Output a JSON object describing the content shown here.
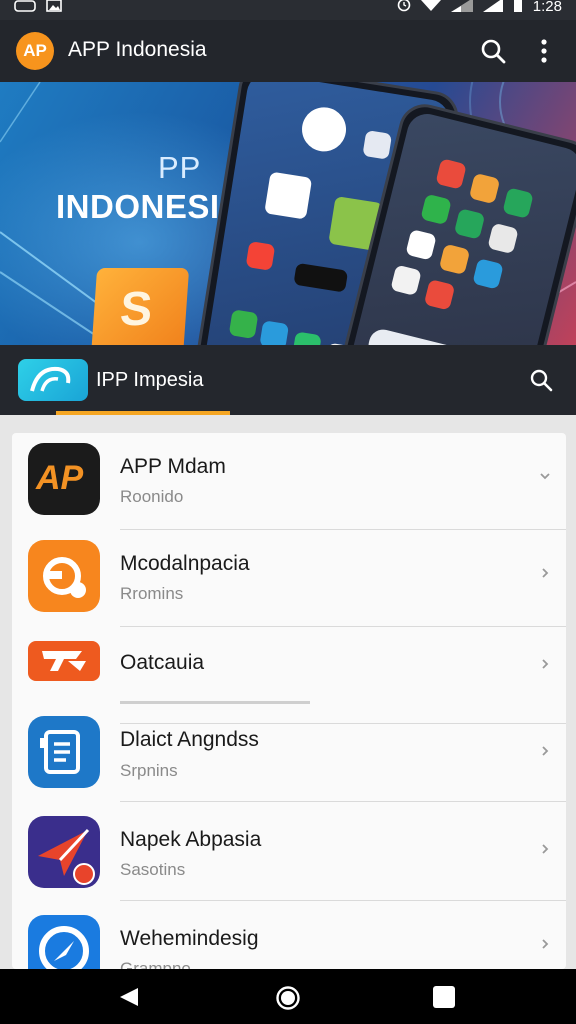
{
  "status_bar": {
    "time": "1:28"
  },
  "app_bar": {
    "logo_text": "AP",
    "title": "APP Indonesia"
  },
  "banner": {
    "subtitle": "PP",
    "title": "INDONESIA",
    "tile_letter": "S"
  },
  "tab": {
    "label": "IPP Impesia"
  },
  "apps": [
    {
      "name": "APP Mdam",
      "subtitle": "Roonido",
      "icon_text": "AP",
      "icon_color": "#1b1b1b",
      "accent": "#f39224"
    },
    {
      "name": "Mcodalnpacia",
      "subtitle": "Rromins",
      "icon_text": "",
      "icon_color": "#f7861e",
      "accent": "#ffffff"
    },
    {
      "name": "Oatcauia",
      "subtitle": "",
      "icon_text": "",
      "icon_color": "#ee5a1f",
      "accent": "#ffffff"
    },
    {
      "name": "Dlaict Angndss",
      "subtitle": "Srpnins",
      "icon_text": "",
      "icon_color": "#1e78c8",
      "accent": "#ffffff"
    },
    {
      "name": "Napek Abpasia",
      "subtitle": "Sasotins",
      "icon_text": "",
      "icon_color": "#3a2e8c",
      "accent": "#e8442b"
    },
    {
      "name": "Wehemindesig",
      "subtitle": "Grampno",
      "icon_text": "",
      "icon_color": "#1a7be0",
      "accent": "#ffffff"
    }
  ]
}
